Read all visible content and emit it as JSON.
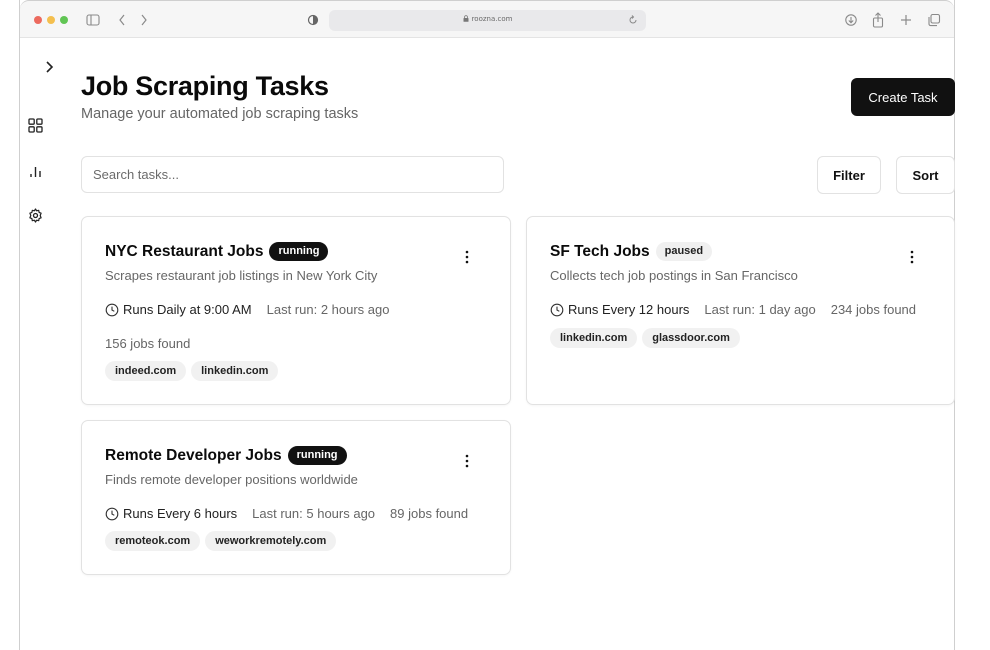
{
  "browser": {
    "url": "roozna.com"
  },
  "header": {
    "title": "Job Scraping Tasks",
    "subtitle": "Manage your automated job scraping tasks",
    "create_label": "Create Task"
  },
  "toolbar": {
    "search_placeholder": "Search tasks...",
    "filter_label": "Filter",
    "sort_label": "Sort"
  },
  "sidebar": {
    "items": [
      {
        "icon": "chevron-right-icon"
      },
      {
        "icon": "dashboard-icon"
      },
      {
        "icon": "bar-chart-icon"
      },
      {
        "icon": "gear-icon"
      }
    ]
  },
  "tasks": [
    {
      "title": "NYC Restaurant Jobs",
      "status": "running",
      "description": "Scrapes restaurant job listings in New York City",
      "schedule": "Runs Daily at 9:00 AM",
      "last_run": "Last run: 2 hours ago",
      "jobs_found": "156 jobs found",
      "sources": [
        "indeed.com",
        "linkedin.com"
      ]
    },
    {
      "title": "SF Tech Jobs",
      "status": "paused",
      "description": "Collects tech job postings in San Francisco",
      "schedule": "Runs Every 12 hours",
      "last_run": "Last run: 1 day ago",
      "jobs_found": "234 jobs found",
      "sources": [
        "linkedin.com",
        "glassdoor.com"
      ]
    },
    {
      "title": "Remote Developer Jobs",
      "status": "running",
      "description": "Finds remote developer positions worldwide",
      "schedule": "Runs Every 6 hours",
      "last_run": "Last run: 5 hours ago",
      "jobs_found": "89 jobs found",
      "sources": [
        "remoteok.com",
        "weworkremotely.com"
      ]
    }
  ],
  "colors": {
    "primary": "#111111",
    "muted_text": "#666666",
    "border": "#e2e2e2",
    "tag_bg": "#f1f1f1"
  }
}
